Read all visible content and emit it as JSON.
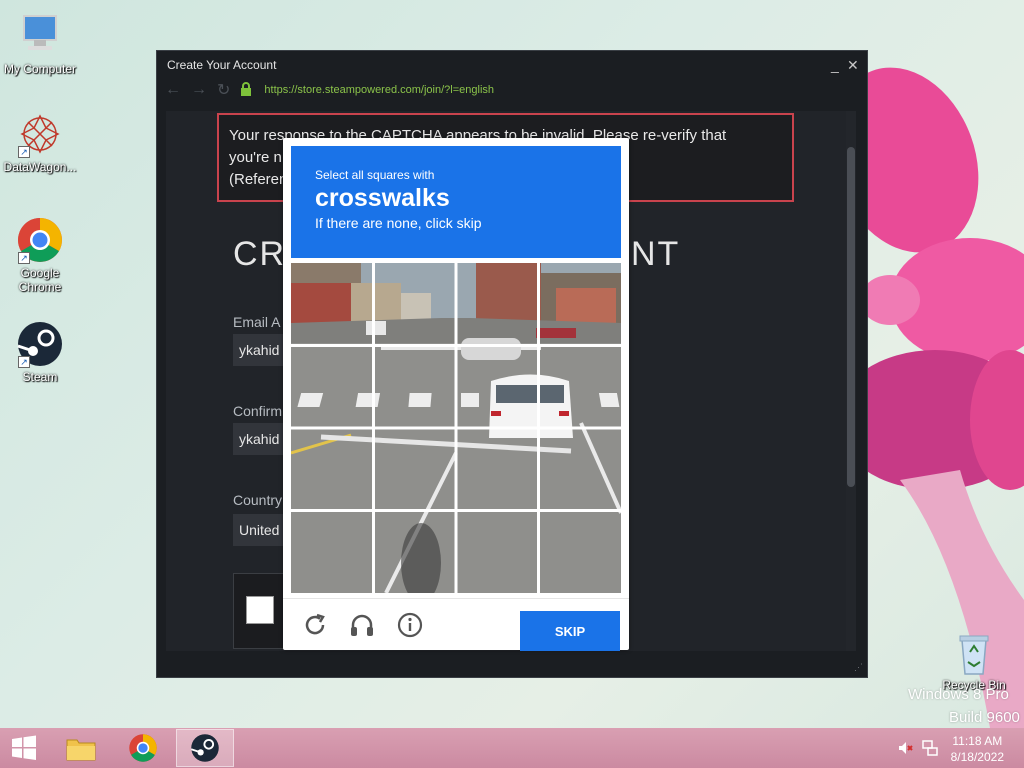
{
  "desktop": {
    "icons": [
      {
        "label": "My Computer"
      },
      {
        "label": "DataWagon..."
      },
      {
        "label": "Google Chrome"
      },
      {
        "label": "Steam"
      },
      {
        "label": "Recycle Bin"
      }
    ],
    "watermark": {
      "line1": "Windows 8 Pro",
      "line2": "Build 9600"
    }
  },
  "window": {
    "title": "Create Your Account",
    "url": "https://store.steampowered.com/join/?l=english",
    "minimize": "_",
    "close": "✕"
  },
  "page": {
    "error_line1": "Your response to the CAPTCHA appears to be invalid. Please re-verify that",
    "error_line2": "you're n",
    "error_line3": "(Referen",
    "heading_left": "CRE",
    "heading_right": "NT",
    "email_label": "Email A",
    "email_value": "ykahid",
    "confirm_label": "Confirm",
    "confirm_value": "ykahid",
    "country_label": "Country",
    "country_value": "United"
  },
  "captcha": {
    "instruction": "Select all squares with",
    "target": "crosswalks",
    "hint": "If there are none, click skip",
    "skip_label": "SKIP",
    "grid_rows": 4,
    "grid_cols": 4
  },
  "taskbar": {
    "time": "11:18 AM",
    "date": "8/18/2022"
  },
  "colors": {
    "captcha_blue": "#1a73e8",
    "error_border": "#c9434d",
    "url_green": "#8bc34a",
    "steam_bg": "#1b1e22"
  }
}
